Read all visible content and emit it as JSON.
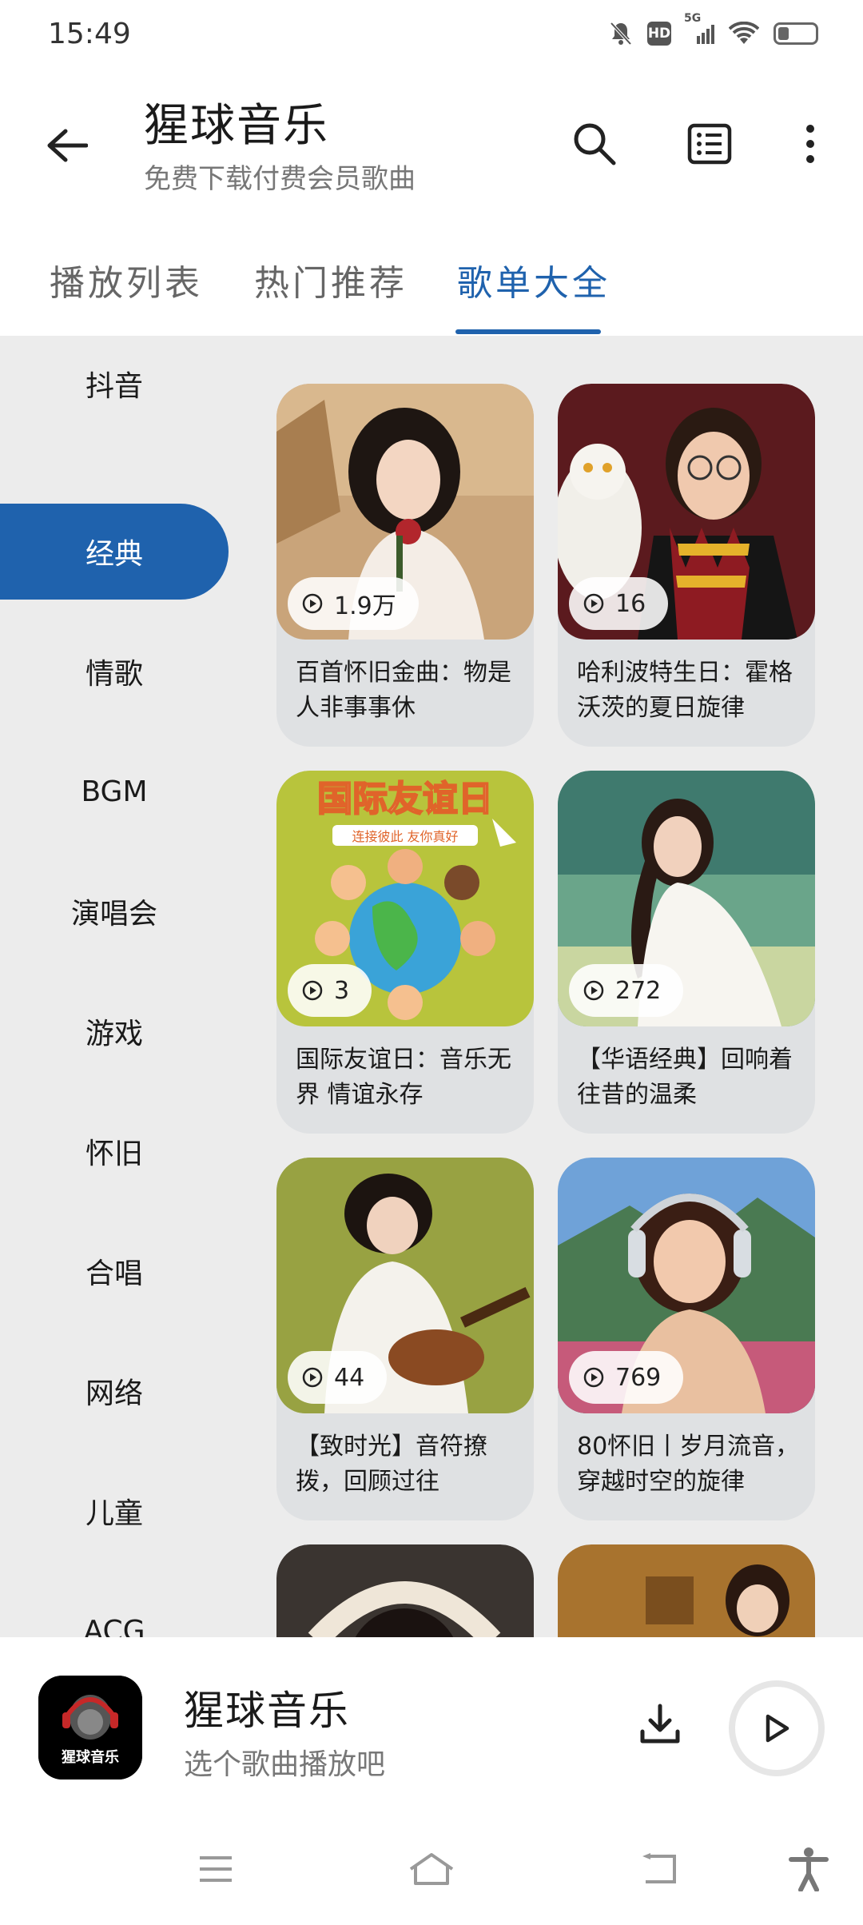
{
  "status": {
    "time": "15:49",
    "hd": "HD",
    "network": "5G"
  },
  "header": {
    "title": "猩球音乐",
    "subtitle": "免费下载付费会员歌曲"
  },
  "tabs": [
    {
      "label": "播放列表",
      "active": false
    },
    {
      "label": "热门推荐",
      "active": false
    },
    {
      "label": "歌单大全",
      "active": true
    }
  ],
  "sidebar": {
    "items": [
      {
        "label": "抖音",
        "active": false
      },
      {
        "label": "经典",
        "active": true
      },
      {
        "label": "情歌",
        "active": false
      },
      {
        "label": "BGM",
        "active": false
      },
      {
        "label": "演唱会",
        "active": false
      },
      {
        "label": "游戏",
        "active": false
      },
      {
        "label": "怀旧",
        "active": false
      },
      {
        "label": "合唱",
        "active": false
      },
      {
        "label": "网络",
        "active": false
      },
      {
        "label": "儿童",
        "active": false
      },
      {
        "label": "ACG",
        "active": false
      }
    ]
  },
  "playlists": [
    {
      "count": "1.9万",
      "title": "百首怀旧金曲：物是人非事事休",
      "cover": "woman-with-rose"
    },
    {
      "count": "16",
      "title": "哈利波特生日：霍格沃茨的夏日旋律",
      "cover": "boy-with-owl"
    },
    {
      "count": "3",
      "title": "国际友谊日：音乐无界 情谊永存",
      "cover": "friendship-day-poster",
      "cover_text": "国际友谊日",
      "cover_subtext": "连接彼此 友你真好"
    },
    {
      "count": "272",
      "title": "【华语经典】回响着往昔的温柔",
      "cover": "woman-in-white-dress"
    },
    {
      "count": "44",
      "title": "【致时光】音符撩拨，回顾过往",
      "cover": "girl-with-ukulele"
    },
    {
      "count": "769",
      "title": "80怀旧丨岁月流音，穿越时空的旋律",
      "cover": "girl-with-headphones"
    },
    {
      "count": "",
      "title": "",
      "cover": "woman-with-lace-headpiece"
    },
    {
      "count": "",
      "title": "",
      "cover": "woman-in-vintage-room"
    }
  ],
  "player": {
    "title": "猩球音乐",
    "subtitle": "选个歌曲播放吧",
    "cover_text": "猩球音乐"
  },
  "colors": {
    "accent": "#1f62ad",
    "content_bg": "#ececec",
    "card_bg": "#dfe1e3"
  }
}
